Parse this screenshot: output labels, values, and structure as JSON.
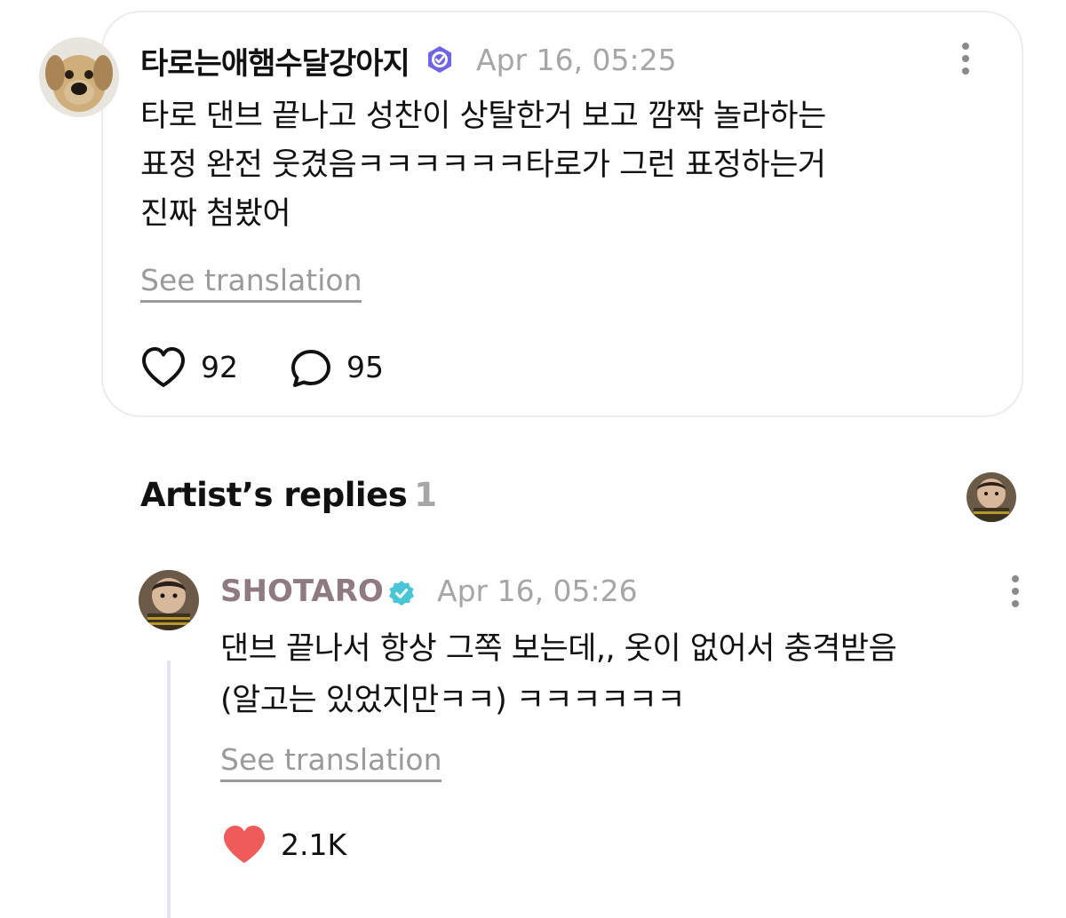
{
  "post": {
    "username": "타로는애햄수달강아지",
    "timestamp": "Apr 16, 05:25",
    "text": "타로 댄브 끝나고 성찬이 상탈한거 보고 깜짝 놀라하는\n표정 완전 웃겼음ㅋㅋㅋㅋㅋㅋ타로가 그런 표정하는거\n진짜 첨봤어",
    "see_translation": "See translation",
    "likes": "92",
    "comments": "95"
  },
  "artist_replies": {
    "title": "Artist’s replies",
    "count": "1",
    "reply": {
      "username": "SHOTARO",
      "timestamp": "Apr 16, 05:26",
      "text": "댄브 끝나서 항상 그쪽 보는데,, 옷이 없어서 충격받음\n(알고는 있었지만ㅋㅋ) ㅋㅋㅋㅋㅋㅋ",
      "see_translation": "See translation",
      "likes": "2.1K"
    }
  },
  "colors": {
    "card_border": "#ececec",
    "timestamp": "#a6a6a6",
    "artist_name": "#8e7a80",
    "verified_badge_user": "#6f63e8",
    "verified_badge_artist": "#49c6d6",
    "liked_heart": "#ef5a5a",
    "thread_line": "#e4e4ee"
  },
  "icons": {
    "like": "heart-outline-icon",
    "comment": "speech-bubble-icon",
    "liked": "heart-filled-icon",
    "more": "more-vertical-icon",
    "verified": "verified-badge-icon"
  }
}
